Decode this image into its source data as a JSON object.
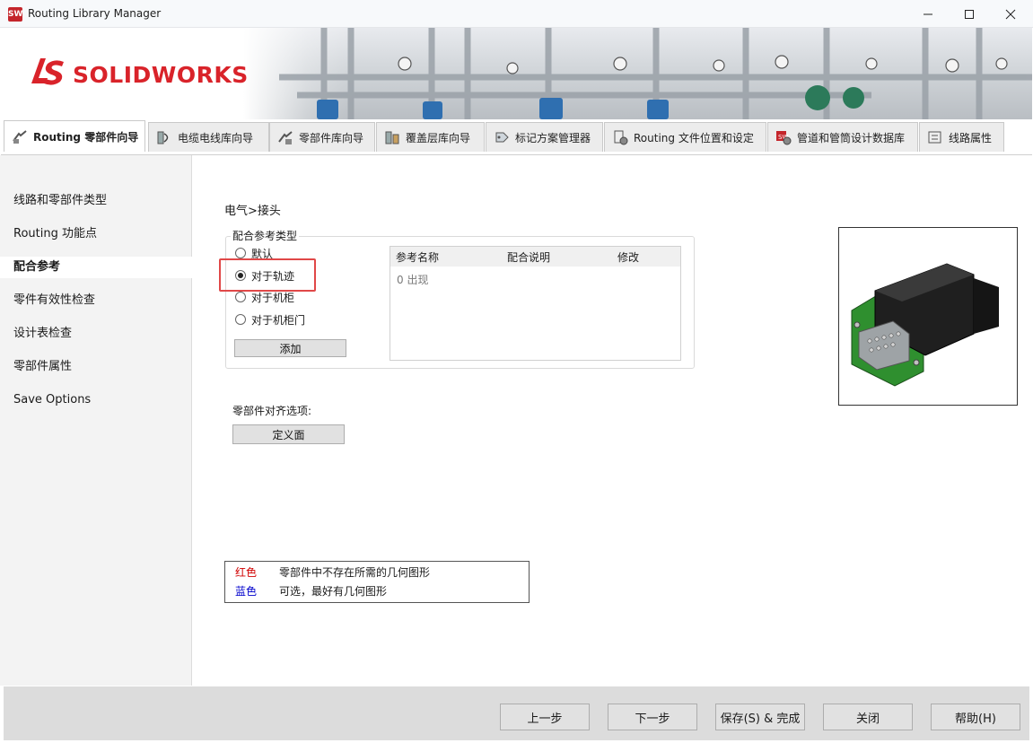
{
  "window": {
    "title": "Routing Library Manager",
    "icon": "sw-app-icon"
  },
  "banner": {
    "logo_text": "SOLIDWORKS"
  },
  "tabs": [
    {
      "label": "Routing 零部件向导",
      "icon": "routing-component-icon",
      "active": true
    },
    {
      "label": "电缆电线库向导",
      "icon": "cable-library-icon"
    },
    {
      "label": "零部件库向导",
      "icon": "component-library-icon"
    },
    {
      "label": "覆盖层库向导",
      "icon": "covering-library-icon"
    },
    {
      "label": "标记方案管理器",
      "icon": "tag-scheme-icon"
    },
    {
      "label": "Routing 文件位置和设定",
      "icon": "file-location-icon"
    },
    {
      "label": "管道和管筒设计数据库",
      "icon": "pipe-database-icon"
    },
    {
      "label": "线路属性",
      "icon": "route-properties-icon"
    }
  ],
  "sidebar": {
    "items": [
      {
        "label": "线路和零部件类型"
      },
      {
        "label": "Routing 功能点"
      },
      {
        "label": "配合参考",
        "selected": true
      },
      {
        "label": "零件有效性检查"
      },
      {
        "label": "设计表检查"
      },
      {
        "label": "零部件属性"
      },
      {
        "label": "Save Options"
      }
    ]
  },
  "main": {
    "breadcrumb": "电气>接头",
    "mate_group": {
      "legend": "配合参考类型",
      "options": [
        {
          "label": "默认",
          "checked": false
        },
        {
          "label": "对于轨迹",
          "checked": true
        },
        {
          "label": "对于机柜",
          "checked": false
        },
        {
          "label": "对于机柜门",
          "checked": false
        }
      ],
      "add_button": "添加",
      "table": {
        "columns": [
          "参考名称",
          "配合说明",
          "修改"
        ],
        "empty_text": "0 出现"
      }
    },
    "align": {
      "label": "零部件对齐选项:",
      "button": "定义面"
    },
    "legend": {
      "red_label": "红色",
      "red_text": "零部件中不存在所需的几何图形",
      "blue_label": "蓝色",
      "blue_text": "可选，最好有几何图形",
      "red_color": "#d00000",
      "blue_color": "#0000cc"
    }
  },
  "footer": {
    "prev": "上一步",
    "next": "下一步",
    "save_finish": "保存(S) & 完成",
    "close": "关闭",
    "help": "帮助(H)"
  }
}
